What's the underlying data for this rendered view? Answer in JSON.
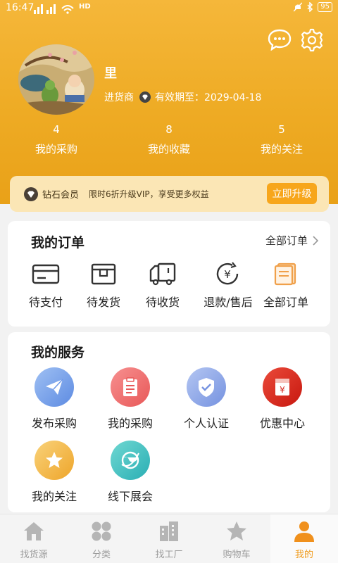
{
  "status_bar": {
    "time": "16:47",
    "network": "HD",
    "battery": "95"
  },
  "profile": {
    "name": "里",
    "role": "进货商",
    "valid_until": "有效期至：2029-04-18"
  },
  "stats": [
    {
      "count": "4",
      "label": "我的采购"
    },
    {
      "count": "8",
      "label": "我的收藏"
    },
    {
      "count": "5",
      "label": "我的关注"
    }
  ],
  "vip": {
    "name": "钻石会员",
    "description": "限时6折升级VIP，享受更多权益",
    "button": "立即升级"
  },
  "orders": {
    "title": "我的订单",
    "all_link": "全部订单",
    "items": [
      {
        "label": "待支付",
        "icon": "card-icon"
      },
      {
        "label": "待发货",
        "icon": "box-icon"
      },
      {
        "label": "待收货",
        "icon": "truck-icon"
      },
      {
        "label": "退款/售后",
        "icon": "refund-icon"
      },
      {
        "label": "全部订单",
        "icon": "document-icon"
      }
    ]
  },
  "services": {
    "title": "我的服务",
    "items": [
      {
        "label": "发布采购",
        "icon": "paper-plane-icon",
        "color": "#6d98e8"
      },
      {
        "label": "我的采购",
        "icon": "clipboard-icon",
        "color": "#ee6a6a"
      },
      {
        "label": "个人认证",
        "icon": "shield-icon",
        "color": "#86a3e8"
      },
      {
        "label": "优惠中心",
        "icon": "coupon-icon",
        "color": "#e03227"
      },
      {
        "label": "我的关注",
        "icon": "star-icon",
        "color": "#f2b73c"
      },
      {
        "label": "线下展会",
        "icon": "globe-icon",
        "color": "#3cbdbd"
      }
    ]
  },
  "nav": [
    {
      "label": "找货源",
      "icon": "home-icon"
    },
    {
      "label": "分类",
      "icon": "grid-icon"
    },
    {
      "label": "找工厂",
      "icon": "building-icon"
    },
    {
      "label": "购物车",
      "icon": "star-nav-icon"
    },
    {
      "label": "我的",
      "icon": "person-icon"
    }
  ],
  "colors": {
    "accent": "#f0a11c",
    "header": "#eeab24"
  }
}
